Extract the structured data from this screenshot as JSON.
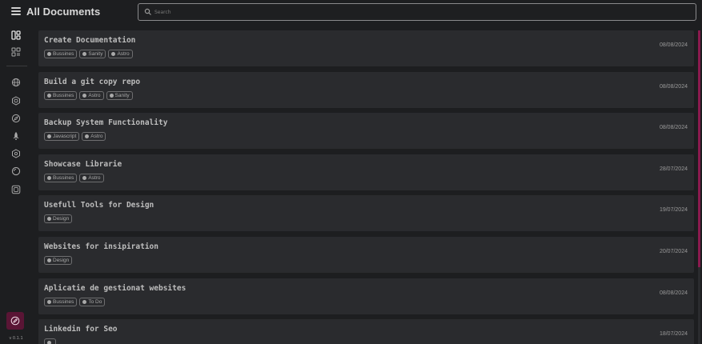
{
  "header": {
    "title": "All Documents",
    "menu_icon": "hamburger-icon"
  },
  "search": {
    "placeholder": "Search",
    "value": ""
  },
  "sidebar": {
    "items": [
      {
        "name": "dashboard-icon"
      },
      {
        "name": "grid-icon"
      },
      {
        "name": "globe-icon"
      },
      {
        "name": "cube-icon"
      },
      {
        "name": "compass-icon"
      },
      {
        "name": "rocket-icon"
      },
      {
        "name": "hexagon-icon"
      },
      {
        "name": "circle-icon"
      },
      {
        "name": "square-icon"
      }
    ],
    "new_button_icon": "edit-icon",
    "version": "v 0.1.1"
  },
  "documents": [
    {
      "title": "Create Documentation",
      "date": "08/08/2024",
      "tags": [
        "Bussines",
        "Sanity",
        "Astro"
      ]
    },
    {
      "title": "Build a git copy repo",
      "date": "08/08/2024",
      "tags": [
        "Bussines",
        "Astro",
        "Sanity"
      ]
    },
    {
      "title": "Backup System Functionality",
      "date": "08/08/2024",
      "tags": [
        "Javascript",
        "Astro"
      ]
    },
    {
      "title": "Showcase Librarie",
      "date": "28/07/2024",
      "tags": [
        "Bussines",
        "Astro"
      ]
    },
    {
      "title": "Usefull Tools for Design",
      "date": "19/07/2024",
      "tags": [
        "Design"
      ]
    },
    {
      "title": "Websites for insipiration",
      "date": "20/07/2024",
      "tags": [
        "Design"
      ]
    },
    {
      "title": "Aplicatie de gestionat websites",
      "date": "08/08/2024",
      "tags": [
        "Bussines",
        "To Do"
      ]
    },
    {
      "title": "Linkedin for Seo",
      "date": "18/07/2024",
      "tags": [
        ""
      ]
    }
  ],
  "colors": {
    "background": "#1d1e20",
    "card": "#2a2b2e",
    "accent": "#8a1a4e",
    "new_button": "#5a1535"
  }
}
